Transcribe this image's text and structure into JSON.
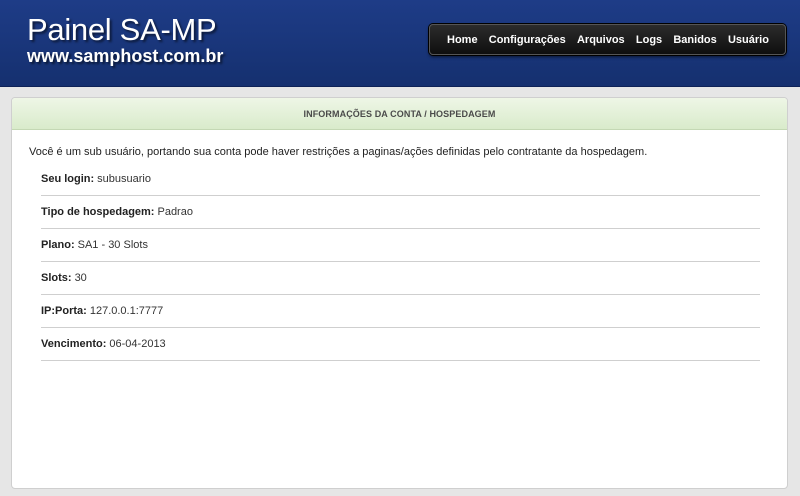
{
  "header": {
    "title": "Painel SA-MP",
    "subtitle": "www.samphost.com.br",
    "colors": {
      "background": "#1a3579",
      "nav_background": "#1b1b1b"
    }
  },
  "nav": {
    "items": [
      {
        "id": "home",
        "label": "Home"
      },
      {
        "id": "configuracoes",
        "label": "Configurações"
      },
      {
        "id": "arquivos",
        "label": "Arquivos"
      },
      {
        "id": "logs",
        "label": "Logs"
      },
      {
        "id": "banidos",
        "label": "Banidos"
      },
      {
        "id": "usuario",
        "label": "Usuário"
      }
    ]
  },
  "panel": {
    "title": "INFORMAÇÕES DA CONTA / HOSPEDAGEM",
    "header_color": "#dcedcf",
    "intro": "Você é um sub usuário, portando sua conta pode haver restrições a paginas/ações definidas pelo contratante da hospedagem.",
    "rows": [
      {
        "label": "Seu login:",
        "value": "subusuario"
      },
      {
        "label": "Tipo de hospedagem:",
        "value": "Padrao"
      },
      {
        "label": "Plano:",
        "value": "SA1 - 30 Slots"
      },
      {
        "label": "Slots:",
        "value": "30"
      },
      {
        "label": "IP:Porta:",
        "value": "127.0.0.1:7777"
      },
      {
        "label": "Vencimento:",
        "value": "06-04-2013"
      }
    ]
  }
}
